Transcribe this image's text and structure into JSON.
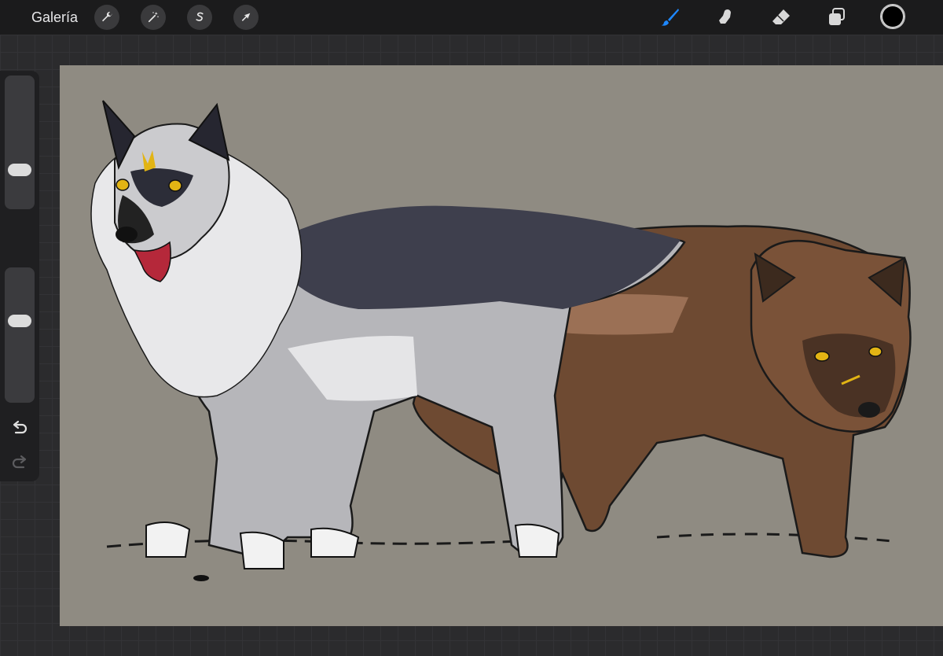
{
  "topbar": {
    "gallery_label": "Galería",
    "left_tools": [
      {
        "name": "actions",
        "icon": "wrench-icon"
      },
      {
        "name": "adjustments",
        "icon": "magic-wand-icon"
      },
      {
        "name": "selection",
        "icon": "selection-s-icon"
      },
      {
        "name": "transform",
        "icon": "arrow-cursor-icon"
      }
    ],
    "right_tools": [
      {
        "name": "paint",
        "icon": "brush-icon",
        "active": true,
        "color": "#1e88ff"
      },
      {
        "name": "smudge",
        "icon": "smudge-finger-icon",
        "active": false
      },
      {
        "name": "erase",
        "icon": "eraser-icon",
        "active": false
      },
      {
        "name": "layers",
        "icon": "layers-icon",
        "active": false
      }
    ],
    "current_color": "#000000"
  },
  "sidebar": {
    "brush_size_icon": "slider-size",
    "brush_opacity_icon": "slider-opacity",
    "brush_size_level": 0.3,
    "brush_opacity_level": 0.35,
    "modify_icon": "square-modify-icon",
    "undo_icon": "undo-icon",
    "redo_icon": "redo-icon"
  },
  "canvas": {
    "background_color": "#8f8b82",
    "artwork_description_icon": "wolf-drawing-illustration"
  }
}
